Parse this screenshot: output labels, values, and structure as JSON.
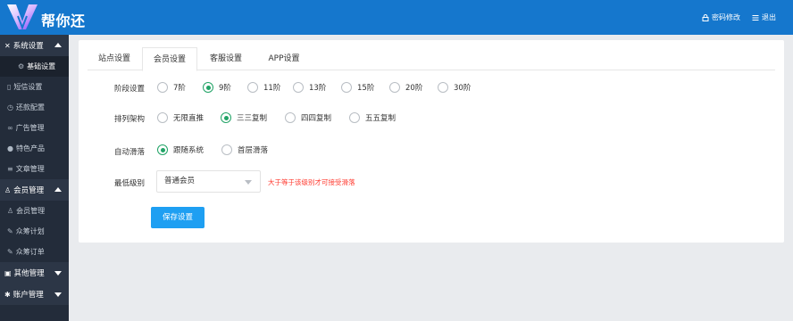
{
  "header": {
    "brand": "帮你还",
    "change_password": "密码修改",
    "logout": "退出",
    "colors": {
      "bar": "#1577cd"
    }
  },
  "sidebar": {
    "groups": [
      {
        "label": "系统设置",
        "icon": "wrench-icon",
        "expanded": true,
        "items": [
          {
            "label": "基础设置",
            "icon": "gear-icon",
            "active": true
          },
          {
            "label": "短信设置",
            "icon": "message-icon"
          },
          {
            "label": "还款配置",
            "icon": "clock-icon"
          },
          {
            "label": "广告管理",
            "icon": "megaphone-icon"
          },
          {
            "label": "特色产品",
            "icon": "bell-icon"
          },
          {
            "label": "文章管理",
            "icon": "list-icon"
          }
        ]
      },
      {
        "label": "会员管理",
        "icon": "user-icon",
        "expanded": true,
        "items": [
          {
            "label": "会员管理",
            "icon": "person-icon"
          },
          {
            "label": "众筹计划",
            "icon": "edit-icon"
          },
          {
            "label": "众筹订单",
            "icon": "edit-icon"
          }
        ]
      },
      {
        "label": "其他管理",
        "icon": "book-icon",
        "expanded": false,
        "items": []
      },
      {
        "label": "账户管理",
        "icon": "cog-icon",
        "expanded": false,
        "items": []
      }
    ]
  },
  "tabs": [
    "站点设置",
    "会员设置",
    "客服设置",
    "APP设置"
  ],
  "active_tab": 1,
  "form": {
    "stage": {
      "label": "阶段设置",
      "options": [
        "7阶",
        "9阶",
        "11阶",
        "13阶",
        "15阶",
        "20阶",
        "30阶"
      ],
      "selected": 1
    },
    "structure": {
      "label": "排列架构",
      "options": [
        "无限直推",
        "三三复制",
        "四四复制",
        "五五复制"
      ],
      "selected": 1
    },
    "auto_slide": {
      "label": "自动滑落",
      "options": [
        "跟随系统",
        "首层滑落"
      ],
      "selected": 0
    },
    "min_level": {
      "label": "最低级别",
      "value": "普通会员",
      "hint": "大于等于该级别才可接受滑落"
    },
    "save_label": "保存设置"
  },
  "accent_colors": {
    "radio": "#21a366",
    "button": "#1e9ff2",
    "hint": "#ff3b30"
  }
}
